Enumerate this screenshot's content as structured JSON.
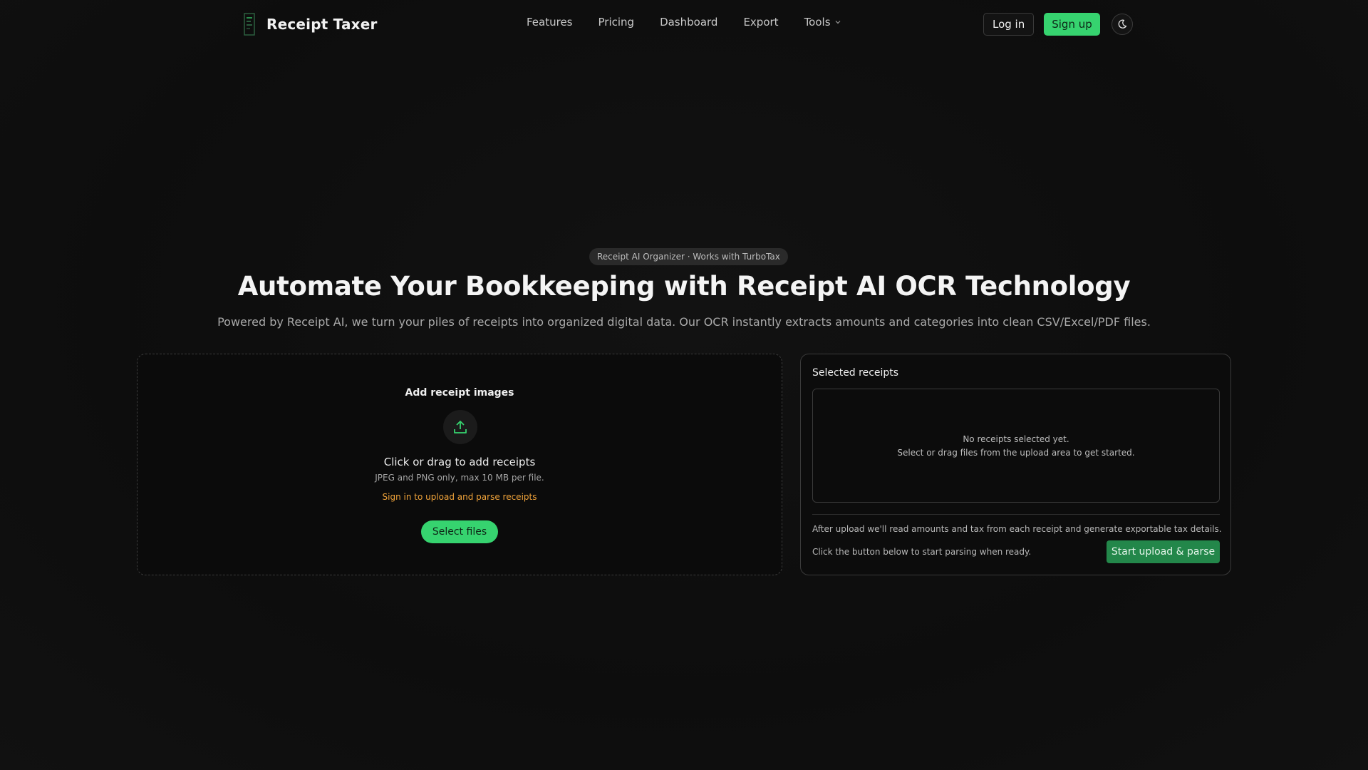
{
  "brand": {
    "name": "Receipt Taxer",
    "logo_icon": "receipt-logo-icon"
  },
  "nav": {
    "items": [
      {
        "label": "Features"
      },
      {
        "label": "Pricing"
      },
      {
        "label": "Dashboard"
      },
      {
        "label": "Export"
      },
      {
        "label": "Tools"
      }
    ],
    "login_label": "Log in",
    "signup_label": "Sign up",
    "theme_icon": "moon-icon"
  },
  "hero": {
    "badge": "Receipt AI Organizer · Works with TurboTax",
    "title": "Automate Your Bookkeeping with Receipt AI OCR Technology",
    "subtitle": "Powered by Receipt AI, we turn your piles of receipts into organized digital data. Our OCR instantly extracts amounts and categories into clean CSV/Excel/PDF files."
  },
  "upload": {
    "title": "Add receipt images",
    "icon": "upload-icon",
    "main": "Click or drag to add receipts",
    "note": "JPEG and PNG only, max 10 MB per file.",
    "warning": "Sign in to upload and parse receipts",
    "button": "Select files"
  },
  "selected": {
    "title": "Selected receipts",
    "empty_line1": "No receipts selected yet.",
    "empty_line2": "Select or drag files from the upload area to get started.",
    "info": "After upload we'll read amounts and tax from each receipt and generate exportable tax details.",
    "hint": "Click the button below to start parsing when ready.",
    "start_button": "Start upload & parse"
  },
  "colors": {
    "accent": "#36d36f",
    "accent_dark": "#23874a",
    "warning": "#f0a33a",
    "background": "#0e0e0e"
  }
}
